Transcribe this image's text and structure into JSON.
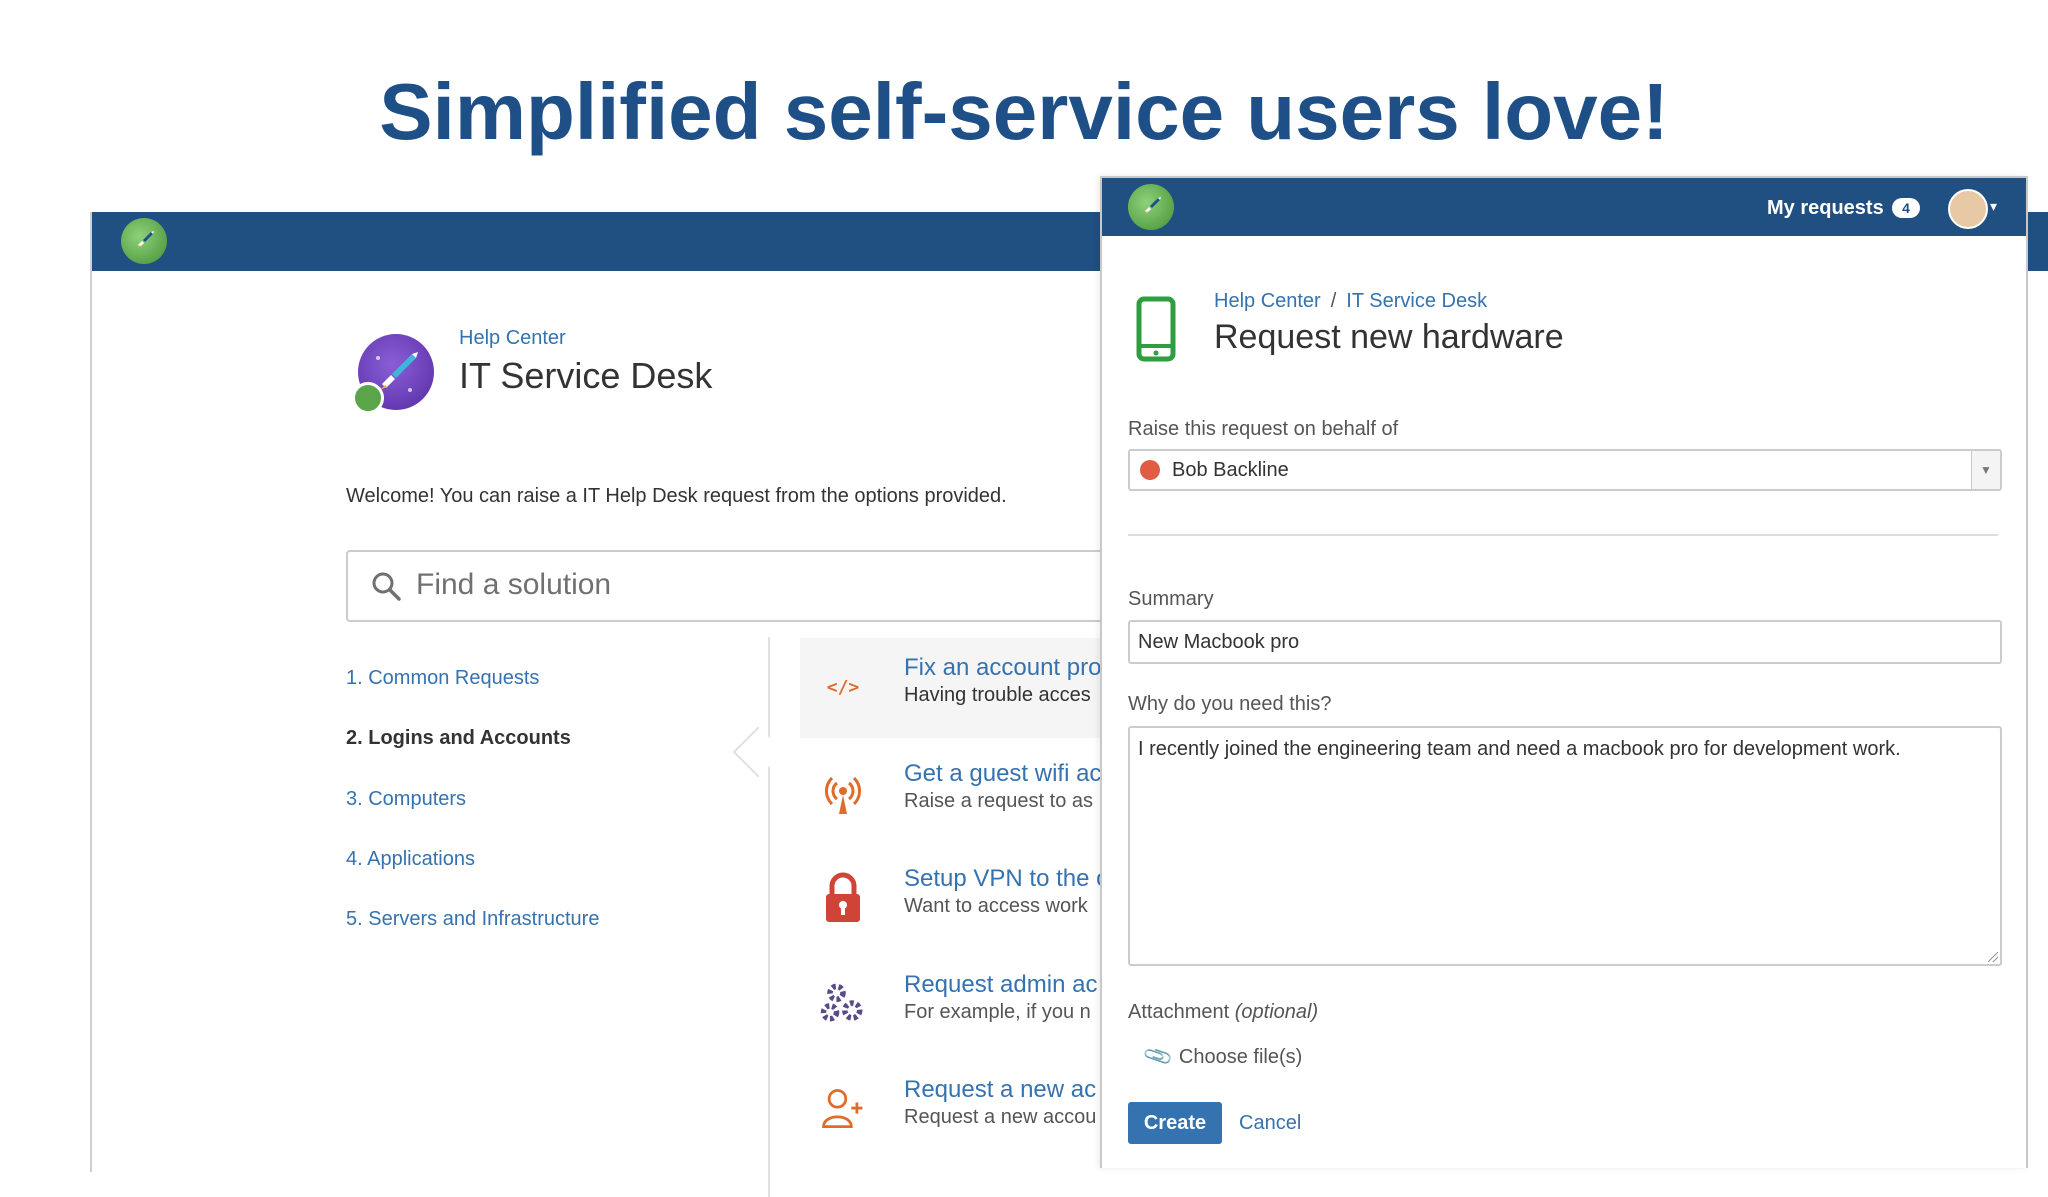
{
  "slide": {
    "title": "Simplified self-service users love!"
  },
  "portal": {
    "breadcrumb": "Help Center",
    "title": "IT Service Desk",
    "welcome": "Welcome! You can raise a IT Help Desk request from the options provided.",
    "search_placeholder": "Find a solution",
    "categories": [
      "1. Common Requests",
      "2. Logins and Accounts",
      "3. Computers",
      "4. Applications",
      "5. Servers and Infrastructure"
    ],
    "active_category": "2. Logins and Accounts",
    "requests": [
      {
        "title": "Fix an account pro",
        "desc": "Having trouble acces",
        "icon": "code-icon"
      },
      {
        "title": "Get a guest wifi ac",
        "desc": "Raise a request to as",
        "icon": "wifi-broadcast-icon"
      },
      {
        "title": "Setup VPN to the o",
        "desc": "Want to access work",
        "icon": "lock-icon"
      },
      {
        "title": "Request admin ac",
        "desc": "For example, if you n",
        "icon": "gears-icon"
      },
      {
        "title": "Request a new ac",
        "desc": "Request a new accou",
        "icon": "add-user-icon"
      }
    ]
  },
  "request_form": {
    "nav": {
      "my_requests_label": "My requests",
      "my_requests_count": "4"
    },
    "breadcrumb": {
      "first": "Help Center",
      "separator": "/",
      "second": "IT Service Desk"
    },
    "title": "Request new hardware",
    "on_behalf_label": "Raise this request on behalf of",
    "on_behalf_value": "Bob Backline",
    "summary_label": "Summary",
    "summary_value": "New Macbook pro",
    "why_label": "Why do you need this?",
    "why_value": "I recently joined the engineering team and need a macbook pro for development work.",
    "attachment_label": "Attachment",
    "attachment_optional": "(optional)",
    "choose_file_label": "Choose file(s)",
    "create_label": "Create",
    "cancel_label": "Cancel"
  },
  "colors": {
    "title_blue": "#1f4f87",
    "nav_blue": "#205081",
    "link_blue": "#3572b0",
    "accent_green": "#5aa44a",
    "icon_orange": "#e06b2b",
    "lock_red": "#d04437",
    "gears_purple": "#5b4a8a"
  }
}
